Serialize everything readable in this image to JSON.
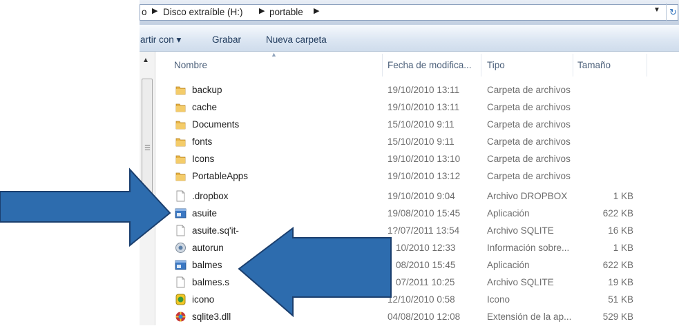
{
  "breadcrumb": {
    "part0": "o",
    "part1": "Disco extraíble (H:)",
    "part2": "portable"
  },
  "toolbar": {
    "share": "artir con ▾",
    "burn": "Grabar",
    "new_folder": "Nueva carpeta"
  },
  "columns": {
    "name": "Nombre",
    "date": "Fecha de modifica...",
    "type": "Tipo",
    "size": "Tamaño"
  },
  "files": [
    {
      "name": "backup",
      "date": "19/10/2010 13:11",
      "type": "Carpeta de archivos",
      "size": "",
      "icon": "folder-icon"
    },
    {
      "name": "cache",
      "date": "19/10/2010 13:11",
      "type": "Carpeta de archivos",
      "size": "",
      "icon": "folder-icon"
    },
    {
      "name": "Documents",
      "date": "15/10/2010 9:11",
      "type": "Carpeta de archivos",
      "size": "",
      "icon": "folder-icon"
    },
    {
      "name": "fonts",
      "date": "15/10/2010 9:11",
      "type": "Carpeta de archivos",
      "size": "",
      "icon": "folder-icon"
    },
    {
      "name": "Icons",
      "date": "19/10/2010 13:10",
      "type": "Carpeta de archivos",
      "size": "",
      "icon": "folder-icon"
    },
    {
      "name": "PortableApps",
      "date": "19/10/2010 13:12",
      "type": "Carpeta de archivos",
      "size": "",
      "icon": "folder-icon"
    },
    {
      "name": ".dropbox",
      "date": "19/10/2010 9:04",
      "type": "Archivo DROPBOX",
      "size": "1 KB",
      "icon": "file-icon"
    },
    {
      "name": "asuite",
      "date": "19/08/2010 15:45",
      "type": "Aplicación",
      "size": "622 KB",
      "icon": "application-icon"
    },
    {
      "name": "asuite.sq'it-",
      "date": "1?/07/2011 13:54",
      "type": "Archivo SQLITE",
      "size": "16 KB",
      "icon": "file-icon"
    },
    {
      "name": "autorun",
      "date": "10/2010 12:33",
      "type": "Información sobre...",
      "size": "1 KB",
      "icon": "settings-file-icon"
    },
    {
      "name": "balmes",
      "date": "08/2010 15:45",
      "type": "Aplicación",
      "size": "622 KB",
      "icon": "application-icon"
    },
    {
      "name": "balmes.s",
      "date": "07/2011 10:25",
      "type": "Archivo SQLITE",
      "size": "19 KB",
      "icon": "file-icon"
    },
    {
      "name": "icono",
      "date": "12/10/2010 0:58",
      "type": "Icono",
      "size": "51 KB",
      "icon": "image-icon"
    },
    {
      "name": "sqlite3.dll",
      "date": "04/08/2010 12:08",
      "type": "Extensión de la ap...",
      "size": "529 KB",
      "icon": "dll-icon"
    }
  ],
  "colors": {
    "arrow_fill": "#2d6cae",
    "arrow_stroke": "#1b3f6e",
    "folder": "#e8b444",
    "header_text": "#4c607a"
  }
}
